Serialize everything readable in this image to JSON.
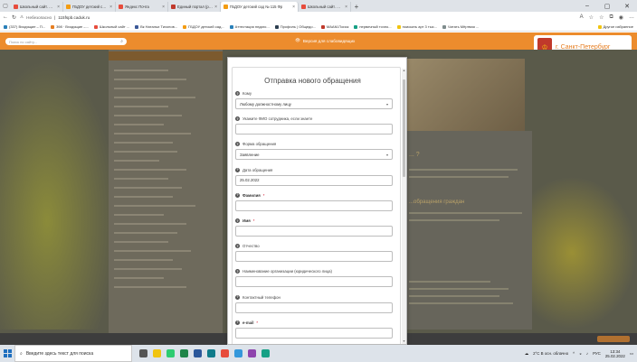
{
  "browser": {
    "tabs": [
      {
        "label": "Школьный сайт. Профиль",
        "color": "#e74c3c",
        "active": false
      },
      {
        "label": "ГБДОУ детский сад № 115 Фр",
        "color": "#f39c12",
        "active": false
      },
      {
        "label": "Яндекс Почта",
        "color": "#e74c3c",
        "active": false
      },
      {
        "label": "Единый портал (руководител",
        "color": "#c0392b",
        "active": false
      },
      {
        "label": "ГБДОУ детский сад № 115 Фр",
        "color": "#f39c12",
        "active": true
      },
      {
        "label": "Школьный сайт. Профиль",
        "color": "#e74c3c",
        "active": false
      }
    ],
    "new_tab": "+",
    "address": {
      "security": "Небезопасно",
      "url": "115fspb.caduk.ru"
    },
    "bookmarks": [
      {
        "label": "(337) Входящие – П...",
        "color": "#2980b9"
      },
      {
        "label": "398 · Входящие –...",
        "color": "#e67e22"
      },
      {
        "label": "Школьный сайт ...",
        "color": "#e74c3c"
      },
      {
        "label": "Вк Натальи Тихонов...",
        "color": "#3b5998"
      },
      {
        "label": "ГБДОУ детский сад...",
        "color": "#f39c12"
      },
      {
        "label": "Аттестация педаго...",
        "color": "#2980b9"
      },
      {
        "label": "Профиль | Общедо...",
        "color": "#2c3e50"
      },
      {
        "label": "МААМ-Поиск",
        "color": "#c0392b"
      },
      {
        "label": "первичный точно...",
        "color": "#16a085"
      },
      {
        "label": "поискать арт 3 тыс...",
        "color": "#f1c40f"
      },
      {
        "label": "Читать Мёртвая ...",
        "color": "#7f8c8d"
      }
    ],
    "bookmarks_other": "Другое избранное"
  },
  "site": {
    "search_placeholder": "Поиск по сайту...",
    "vision_link": "Версия для слабовидящих",
    "city": "г. Санкт-Петербург",
    "bg_heading_1": "... ?",
    "bg_heading_2": "...обращения граждан"
  },
  "modal": {
    "title": "Отправка нового обращения",
    "fields": [
      {
        "label": "Кому",
        "value": "Любому должностному лицу",
        "type": "select",
        "required": false
      },
      {
        "label": "Укажите ФИО сотрудника, если знаете",
        "value": "",
        "type": "text",
        "required": false
      },
      {
        "label": "Форма обращения",
        "value": "Заявление",
        "type": "select",
        "required": false
      },
      {
        "label": "Дата обращения",
        "value": "25.02.2022",
        "type": "text",
        "required": false
      },
      {
        "label": "Фамилия",
        "value": "",
        "type": "text",
        "required": true
      },
      {
        "label": "Имя",
        "value": "",
        "type": "text",
        "required": true
      },
      {
        "label": "Отчество",
        "value": "",
        "type": "text",
        "required": false
      },
      {
        "label": "Наименование организации (юридического лица)",
        "value": "",
        "type": "text",
        "required": false
      },
      {
        "label": "Контактный телефон",
        "value": "",
        "type": "text",
        "required": false
      },
      {
        "label": "e-mail",
        "value": "",
        "type": "text",
        "required": true
      }
    ]
  },
  "taskbar": {
    "search_placeholder": "Введите здесь текст для поиска",
    "weather": "2°C  В осн. облачно",
    "lang": "РУС",
    "time": "13:34",
    "date": "25.02.2022"
  }
}
